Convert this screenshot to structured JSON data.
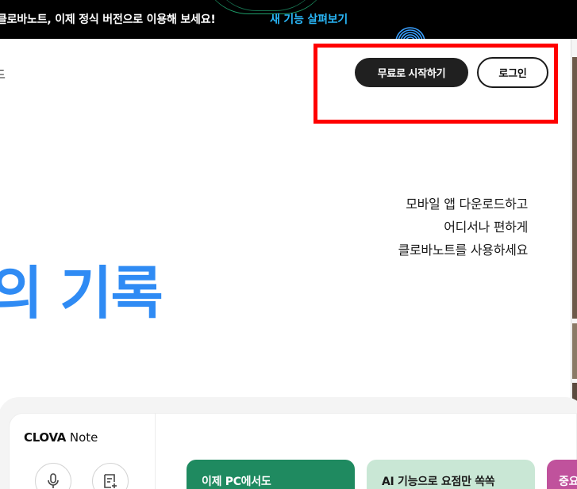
{
  "banner": {
    "message": "클로바노트, 이제 정식 버전으로 이용해 보세요!",
    "link_label": "새 기능 살펴보기"
  },
  "header": {
    "partial_text": "드",
    "start_label": "무료로 시작하기",
    "login_label": "로그인"
  },
  "promo": {
    "lines": [
      "모바일 앱 다운로드하고",
      "어디서나 편하게",
      "클로바노트를 사용하세요"
    ]
  },
  "hero": {
    "title_visible": "의 기록"
  },
  "app_preview": {
    "brand_bold": "CLOVA",
    "brand_rest": "Note",
    "cards": [
      {
        "label": "이제 PC에서도"
      },
      {
        "label": "AI 기능으로 요점만 쏙쏙"
      },
      {
        "label": "중요"
      }
    ]
  },
  "colors": {
    "accent_blue": "#2f8bf4",
    "link_cyan": "#29b6f6",
    "card_green": "#1f8a60",
    "card_mint": "#c9e7d5",
    "card_pink": "#c0529c",
    "highlight_red": "#ff0000"
  },
  "icons": [
    "wave-rings-icon",
    "mic-icon",
    "memo-add-icon"
  ]
}
